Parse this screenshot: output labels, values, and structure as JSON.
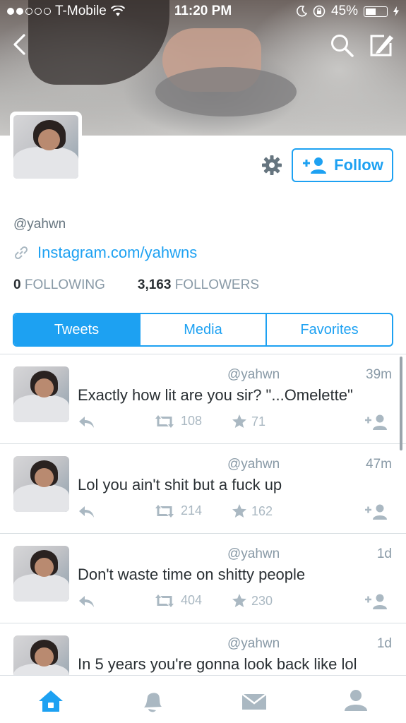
{
  "status_bar": {
    "carrier": "T-Mobile",
    "time": "11:20 PM",
    "battery": "45%"
  },
  "profile": {
    "handle": "@yahwn",
    "link": "Instagram.com/yahwns",
    "following_count": "0",
    "following_label": "FOLLOWING",
    "followers_count": "3,163",
    "followers_label": "FOLLOWERS",
    "follow_label": "Follow"
  },
  "tabs": [
    {
      "label": "Tweets",
      "active": true
    },
    {
      "label": "Media",
      "active": false
    },
    {
      "label": "Favorites",
      "active": false
    }
  ],
  "tweets": [
    {
      "handle": "@yahwn",
      "time": "39m",
      "text": "Exactly how lit are you sir? \"...Omelette\"",
      "retweets": "108",
      "favorites": "71"
    },
    {
      "handle": "@yahwn",
      "time": "47m",
      "text": "Lol you ain't shit but a fuck up",
      "retweets": "214",
      "favorites": "162"
    },
    {
      "handle": "@yahwn",
      "time": "1d",
      "text": "Don't waste time on shitty people",
      "retweets": "404",
      "favorites": "230"
    },
    {
      "handle": "@yahwn",
      "time": "1d",
      "text": "In 5 years you're gonna look back like lol",
      "retweets": "",
      "favorites": ""
    }
  ],
  "icons": {
    "back": "chevron-left-icon",
    "search": "search-icon",
    "compose": "compose-icon",
    "settings": "gear-icon",
    "home": "home-icon",
    "notifications": "bell-icon",
    "messages": "envelope-icon",
    "me": "person-icon"
  },
  "colors": {
    "accent": "#1da1f2",
    "muted": "#8899a6",
    "action_icon": "#aab8c2"
  }
}
